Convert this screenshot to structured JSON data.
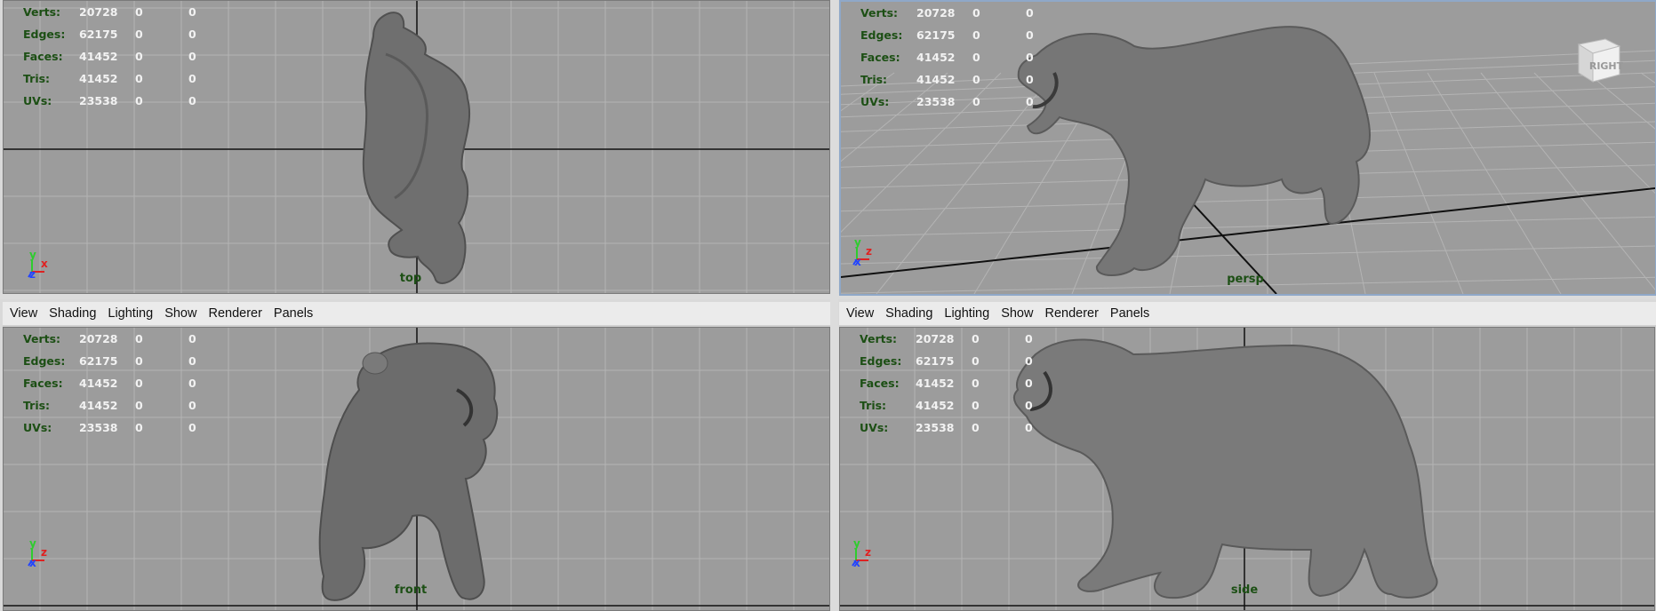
{
  "menu": [
    "View",
    "Shading",
    "Lighting",
    "Show",
    "Renderer",
    "Panels"
  ],
  "stats": [
    {
      "label": "Verts:",
      "value": "20728",
      "sel": "0",
      "tri": "0"
    },
    {
      "label": "Edges:",
      "value": "62175",
      "sel": "0",
      "tri": "0"
    },
    {
      "label": "Faces:",
      "value": "41452",
      "sel": "0",
      "tri": "0"
    },
    {
      "label": "Tris:",
      "value": "41452",
      "sel": "0",
      "tri": "0"
    },
    {
      "label": "UVs:",
      "value": "23538",
      "sel": "0",
      "tri": "0"
    }
  ],
  "viewports": {
    "top": {
      "camera": "top",
      "axes": [
        "Y",
        "X",
        "Z"
      ]
    },
    "persp": {
      "camera": "persp",
      "axes": [
        "Y",
        "Z",
        "X"
      ],
      "viewcube": "RIGHT"
    },
    "front": {
      "camera": "front",
      "axes": [
        "Y",
        "Z",
        "X"
      ]
    },
    "side": {
      "camera": "side",
      "axes": [
        "Y",
        "Z",
        "X"
      ]
    }
  },
  "colors": {
    "viewport": "#9c9c9c",
    "grid": "#b4b4b4",
    "axisline": "#101010",
    "hud_label": "#1c4f14",
    "hud_value": "#f2f2f2",
    "menubar": "#ebebeb"
  },
  "icons": [
    "axis-gizmo-icon",
    "view-cube-icon"
  ]
}
